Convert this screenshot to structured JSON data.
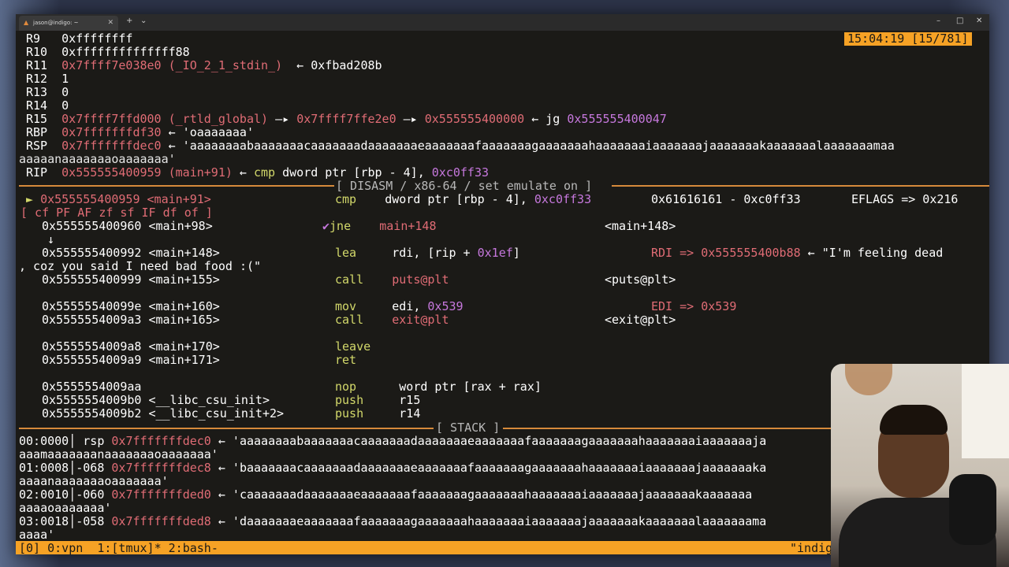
{
  "window": {
    "tab_title": "jason@indigo: ~",
    "minimize": "–",
    "maximize": "□",
    "close": "✕",
    "new_tab": "+",
    "tab_menu": "⌄"
  },
  "clock": "15:04:19 [15/781]",
  "registers": [
    {
      "name": "R9",
      "value": "0xffffffff",
      "rest": ""
    },
    {
      "name": "R10",
      "value": "0xffffffffffffff88",
      "rest": ""
    },
    {
      "name": "R11",
      "value": "0x7ffff7e038e0 (_IO_2_1_stdin_)",
      "rest": "  ← 0xfbad208b"
    },
    {
      "name": "R12",
      "value": "1",
      "rest": ""
    },
    {
      "name": "R13",
      "value": "0",
      "rest": ""
    },
    {
      "name": "R14",
      "value": "0",
      "rest": ""
    }
  ],
  "r15": {
    "name": "R15",
    "a": "0x7ffff7ffd000 (_rtld_global)",
    "arrow1": " —▸ ",
    "b": "0x7ffff7ffe2e0",
    "arrow2": " —▸ ",
    "c": "0x555555400000",
    "arrow3": " ← jg ",
    "d": "0x555555400047"
  },
  "rbp": {
    "name": "RBP",
    "addr": "0x7fffffffdf30",
    "rest": " ← 'oaaaaaaa'"
  },
  "rsp": {
    "name": "RSP",
    "addr": "0x7fffffffdec0",
    "rest": " ← 'aaaaaaaabaaaaaaacaaaaaaadaaaaaaaeaaaaaaafaaaaaaagaaaaaaahaaaaaaaiaaaaaaajaaaaaaakaaaaaaalaaaaaaamaa",
    "cont": "aaaaanaaaaaaaoaaaaaaa'"
  },
  "rip": {
    "name": "RIP",
    "addr": "0x555555400959 (main+91)",
    "arrow": " ← ",
    "op": "cmp",
    "args1": " dword ptr [rbp - 4], ",
    "imm": "0xc0ff33"
  },
  "disasm_header": "[ DISASM / x86-64 / set emulate on ]",
  "stack_header": "[ STACK ]",
  "disasm": {
    "current_marker": "►",
    "rows": [
      {
        "addr": "0x555555400959 <main+91>",
        "op": "cmp",
        "args": "dword ptr [rbp - 4], ",
        "imm": "0xc0ff33",
        "note": "0x61616161 - 0xc0ff33",
        "note2": "EFLAGS => 0x216"
      },
      {
        "addr": "0x555555400960 <main+98>",
        "op": "jne",
        "args": "main+148",
        "note": "<main+148>"
      },
      {
        "addr": "0x555555400992 <main+148>",
        "op": "lea",
        "args": "rdi, [rip + ",
        "imm": "0x1ef",
        "args_tail": "]",
        "note": "RDI => ",
        "note_addr": "0x555555400b88",
        "note_tail": " ← \"I'm feeling dead"
      },
      {
        "addr": "0x555555400999 <main+155>",
        "op": "call",
        "args": "puts@plt",
        "note": "<puts@plt>"
      },
      {
        "addr": "0x55555540099e <main+160>",
        "op": "mov",
        "args": "edi, ",
        "imm": "0x539",
        "note": "EDI => 0x539"
      },
      {
        "addr": "0x5555554009a3 <main+165>",
        "op": "call",
        "args": "exit@plt",
        "note": "<exit@plt>"
      },
      {
        "addr": "0x5555554009a8 <main+170>",
        "op": "leave"
      },
      {
        "addr": "0x5555554009a9 <main+171>",
        "op": "ret"
      },
      {
        "addr": "0x5555554009aa",
        "op": "nop",
        "args": "word ptr [rax + rax]"
      },
      {
        "addr": "0x5555554009b0 <__libc_csu_init>",
        "op": "push",
        "args": "r15"
      },
      {
        "addr": "0x5555554009b2 <__libc_csu_init+2>",
        "op": "push",
        "args": "r14"
      }
    ],
    "flags": "[ cf PF AF zf sf IF df of ]",
    "branch_arrow": "↓",
    "check": "✔",
    "string_cont": ", coz you said I need bad food :(\""
  },
  "stack": [
    {
      "idx": "00:0000│ rsp ",
      "addr": "0x7fffffffdec0",
      "rest": " ← 'aaaaaaaabaaaaaaacaaaaaaadaaaaaaaeaaaaaaafaaaaaaagaaaaaaahaaaaaaaiaaaaaaaja",
      "cont": "aaamaaaaaaanaaaaaaaoaaaaaaa'"
    },
    {
      "idx": "01:0008│-068 ",
      "addr": "0x7fffffffdec8",
      "rest": " ← 'baaaaaaacaaaaaaadaaaaaaaeaaaaaaafaaaaaaagaaaaaaahaaaaaaaiaaaaaaajaaaaaaaka",
      "cont": "aaaanaaaaaaaoaaaaaaa'"
    },
    {
      "idx": "02:0010│-060 ",
      "addr": "0x7fffffffded0",
      "rest": " ← 'caaaaaaadaaaaaaaeaaaaaaafaaaaaaagaaaaaaahaaaaaaaiaaaaaaajaaaaaaakaaaaaaa",
      "cont": "aaaaoaaaaaaa'"
    },
    {
      "idx": "03:0018│-058 ",
      "addr": "0x7fffffffded8",
      "rest": " ← 'daaaaaaaeaaaaaaafaaaaaaagaaaaaaahaaaaaaaiaaaaaaajaaaaaaakaaaaaaalaaaaaaama",
      "cont": "aaaa'"
    }
  ],
  "status_bar": {
    "left": "[0] 0:vpn  1:[tmux]* 2:bash-",
    "right": "\"indig"
  }
}
